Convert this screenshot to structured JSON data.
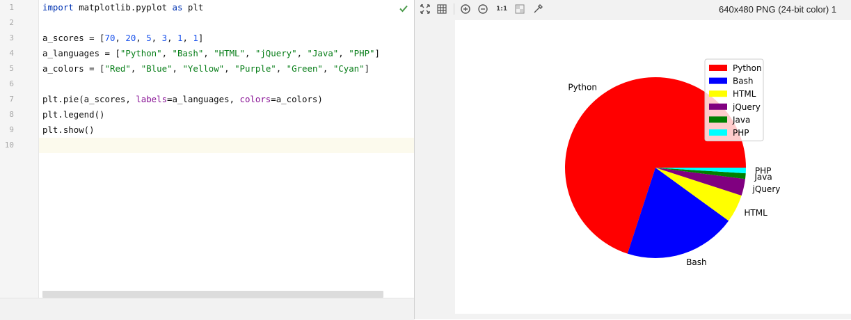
{
  "editor": {
    "line_numbers": [
      "1",
      "2",
      "3",
      "4",
      "5",
      "6",
      "7",
      "8",
      "9",
      "10"
    ],
    "current_line": 10,
    "lines": [
      [
        {
          "t": "import",
          "c": "kw"
        },
        {
          "t": " matplotlib.pyplot ",
          "c": ""
        },
        {
          "t": "as",
          "c": "kw"
        },
        {
          "t": " plt",
          "c": ""
        }
      ],
      [],
      [
        {
          "t": "a_scores = [",
          "c": ""
        },
        {
          "t": "70",
          "c": "num"
        },
        {
          "t": ", ",
          "c": ""
        },
        {
          "t": "20",
          "c": "num"
        },
        {
          "t": ", ",
          "c": ""
        },
        {
          "t": "5",
          "c": "num"
        },
        {
          "t": ", ",
          "c": ""
        },
        {
          "t": "3",
          "c": "num"
        },
        {
          "t": ", ",
          "c": ""
        },
        {
          "t": "1",
          "c": "num"
        },
        {
          "t": ", ",
          "c": ""
        },
        {
          "t": "1",
          "c": "num"
        },
        {
          "t": "]",
          "c": ""
        }
      ],
      [
        {
          "t": "a_languages = [",
          "c": ""
        },
        {
          "t": "\"Python\"",
          "c": "str"
        },
        {
          "t": ", ",
          "c": ""
        },
        {
          "t": "\"Bash\"",
          "c": "str"
        },
        {
          "t": ", ",
          "c": ""
        },
        {
          "t": "\"HTML\"",
          "c": "str"
        },
        {
          "t": ", ",
          "c": ""
        },
        {
          "t": "\"jQuery\"",
          "c": "str"
        },
        {
          "t": ", ",
          "c": ""
        },
        {
          "t": "\"Java\"",
          "c": "str"
        },
        {
          "t": ", ",
          "c": ""
        },
        {
          "t": "\"PHP\"",
          "c": "str"
        },
        {
          "t": "]",
          "c": ""
        }
      ],
      [
        {
          "t": "a_colors = [",
          "c": ""
        },
        {
          "t": "\"Red\"",
          "c": "str"
        },
        {
          "t": ", ",
          "c": ""
        },
        {
          "t": "\"Blue\"",
          "c": "str"
        },
        {
          "t": ", ",
          "c": ""
        },
        {
          "t": "\"Yellow\"",
          "c": "str"
        },
        {
          "t": ", ",
          "c": ""
        },
        {
          "t": "\"Purple\"",
          "c": "str"
        },
        {
          "t": ", ",
          "c": ""
        },
        {
          "t": "\"Green\"",
          "c": "str"
        },
        {
          "t": ", ",
          "c": ""
        },
        {
          "t": "\"Cyan\"",
          "c": "str"
        },
        {
          "t": "]",
          "c": ""
        }
      ],
      [],
      [
        {
          "t": "plt.pie(a_scores, ",
          "c": ""
        },
        {
          "t": "labels",
          "c": "kwa"
        },
        {
          "t": "=a_languages, ",
          "c": ""
        },
        {
          "t": "colors",
          "c": "kwa"
        },
        {
          "t": "=a_colors)",
          "c": ""
        }
      ],
      [
        {
          "t": "plt.legend()",
          "c": ""
        }
      ],
      [
        {
          "t": "plt.show()",
          "c": ""
        }
      ],
      []
    ],
    "inspection_status": "check-icon"
  },
  "viewer": {
    "image_info": "640x480 PNG (24-bit color) 1",
    "toolbar": {
      "fit_icon": "fit-to-window-icon",
      "grid_icon": "grid-icon",
      "zoom_in_icon": "zoom-in-icon",
      "zoom_out_icon": "zoom-out-icon",
      "actual_size_label": "1:1",
      "background_icon": "chessboard-icon",
      "color_picker_icon": "color-picker-icon"
    }
  },
  "chart_data": {
    "type": "pie",
    "categories": [
      "Python",
      "Bash",
      "HTML",
      "jQuery",
      "Java",
      "PHP"
    ],
    "values": [
      70,
      20,
      5,
      3,
      1,
      1
    ],
    "colors": [
      "#ff0000",
      "#0000ff",
      "#ffff00",
      "#800080",
      "#008000",
      "#00ffff"
    ],
    "start_angle": 0,
    "direction": "counterclockwise",
    "legend": {
      "placement": "top-right",
      "entries": [
        "Python",
        "Bash",
        "HTML",
        "jQuery",
        "Java",
        "PHP"
      ]
    }
  }
}
